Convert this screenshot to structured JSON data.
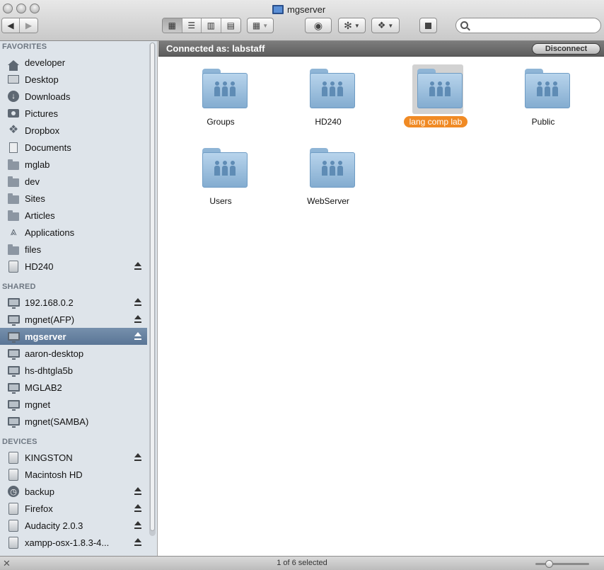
{
  "window": {
    "title": "mgserver"
  },
  "toolbar": {
    "back_icon": "back-arrow-icon",
    "forward_icon": "forward-arrow-icon",
    "view_modes": [
      "icon-view-icon",
      "list-view-icon",
      "column-view-icon",
      "coverflow-view-icon"
    ],
    "active_view": 0,
    "search": {
      "value": "",
      "placeholder": ""
    }
  },
  "sidebar": {
    "favorites_header": "FAVORITES",
    "favorites": [
      {
        "label": "developer",
        "icon": "home-icon"
      },
      {
        "label": "Desktop",
        "icon": "desktop-icon"
      },
      {
        "label": "Downloads",
        "icon": "downloads-icon"
      },
      {
        "label": "Pictures",
        "icon": "camera-icon"
      },
      {
        "label": "Dropbox",
        "icon": "dropbox-icon"
      },
      {
        "label": "Documents",
        "icon": "document-icon"
      },
      {
        "label": "mglab",
        "icon": "folder-icon"
      },
      {
        "label": "dev",
        "icon": "folder-icon"
      },
      {
        "label": "Sites",
        "icon": "folder-icon"
      },
      {
        "label": "Articles",
        "icon": "folder-icon"
      },
      {
        "label": "Applications",
        "icon": "applications-icon"
      },
      {
        "label": "files",
        "icon": "folder-icon"
      },
      {
        "label": "HD240",
        "icon": "drive-icon",
        "eject": true
      }
    ],
    "shared_header": "SHARED",
    "shared": [
      {
        "label": "192.168.0.2",
        "icon": "monitor-icon",
        "eject": true
      },
      {
        "label": "mgnet(AFP)",
        "icon": "monitor-icon",
        "eject": true
      },
      {
        "label": "mgserver",
        "icon": "monitor-icon",
        "eject": true,
        "selected": true
      },
      {
        "label": "aaron-desktop",
        "icon": "monitor-icon"
      },
      {
        "label": "hs-dhtgla5b",
        "icon": "monitor-icon"
      },
      {
        "label": "MGLAB2",
        "icon": "monitor-icon"
      },
      {
        "label": "mgnet",
        "icon": "monitor-icon"
      },
      {
        "label": "mgnet(SAMBA)",
        "icon": "monitor-icon"
      }
    ],
    "devices_header": "DEVICES",
    "devices": [
      {
        "label": "KINGSTON",
        "icon": "drive-icon",
        "eject": true
      },
      {
        "label": "Macintosh HD",
        "icon": "drive-icon"
      },
      {
        "label": "backup",
        "icon": "time-machine-icon",
        "eject": true
      },
      {
        "label": "Firefox",
        "icon": "drive-icon",
        "eject": true
      },
      {
        "label": "Audacity 2.0.3",
        "icon": "drive-icon",
        "eject": true
      },
      {
        "label": "xampp-osx-1.8.3-4...",
        "icon": "drive-icon",
        "eject": true
      }
    ]
  },
  "connection": {
    "text": "Connected as: labstaff",
    "disconnect_label": "Disconnect"
  },
  "items": [
    {
      "label": "Groups",
      "selected": false
    },
    {
      "label": "HD240",
      "selected": false
    },
    {
      "label": "lang comp lab",
      "selected": true
    },
    {
      "label": "Public",
      "selected": false
    },
    {
      "label": "Users",
      "selected": false
    },
    {
      "label": "WebServer",
      "selected": false
    }
  ],
  "status": {
    "text": "1 of 6 selected",
    "icon_size": 0.2
  },
  "colors": {
    "selection_label": "#f08a24",
    "sidebar_selected": "#5a7596"
  }
}
